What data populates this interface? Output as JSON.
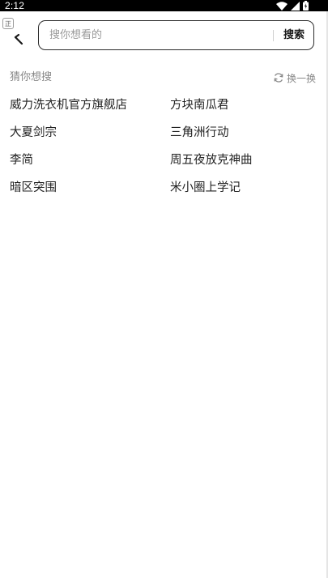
{
  "status_bar": {
    "time": "2:12",
    "icons": [
      "wifi-icon",
      "signal-icon",
      "battery-icon"
    ]
  },
  "header": {
    "badge_text": "正",
    "search": {
      "placeholder": "搜你想看的",
      "value": "",
      "button_label": "搜索"
    }
  },
  "guess": {
    "title": "猜你想搜",
    "refresh_label": "换一换",
    "items": [
      [
        "威力洗衣机官方旗舰店",
        "方块南瓜君"
      ],
      [
        "大夏剑宗",
        "三角洲行动"
      ],
      [
        "李简",
        "周五夜放克神曲"
      ],
      [
        "暗区突围",
        "米小圈上学记"
      ]
    ]
  },
  "colors": {
    "text_primary": "#222222",
    "text_secondary": "#888888",
    "border": "#2b2b2b",
    "status_bar_bg": "#000000"
  }
}
